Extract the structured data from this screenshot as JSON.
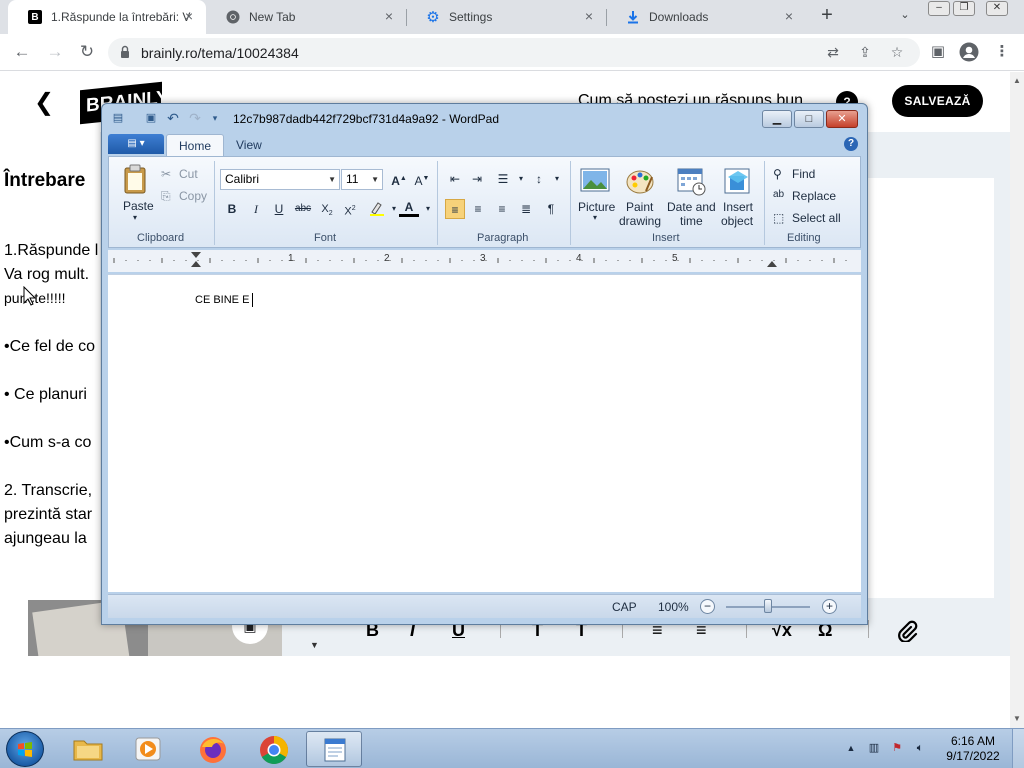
{
  "browser": {
    "tabs": [
      {
        "title": "1.Răspunde la întrebări: V",
        "favicon": "brainly-icon",
        "active": true
      },
      {
        "title": "New Tab",
        "favicon": "chrome-icon",
        "active": false
      },
      {
        "title": "Settings",
        "favicon": "gear-icon",
        "active": false
      },
      {
        "title": "Downloads",
        "favicon": "download-icon",
        "active": false
      }
    ],
    "url": "brainly.ro/tema/10024384"
  },
  "page": {
    "logo": "BRAINLY",
    "how_to_answer": "Cum să postezi un răspuns bun",
    "save_button": "SALVEAZĂ",
    "question_heading": "Întrebare",
    "question_lines": [
      "1.Răspunde l",
      "Va rog mult.",
      "puncte!!!!!",
      "•Ce fel de co",
      "• Ce planuri",
      "•Cum s-a co",
      "2. Transcrie,",
      "prezintă star",
      "ajungeau la"
    ],
    "editor_tools": [
      "B",
      "I",
      "U",
      "T",
      "T",
      "≡",
      "≡",
      "√x",
      "Ω",
      "attach"
    ]
  },
  "wordpad": {
    "title": "12c7b987dadb442f729bcf731d4a9a92 - WordPad",
    "tabs": [
      "Home",
      "View"
    ],
    "clipboard": {
      "paste": "Paste",
      "cut": "Cut",
      "copy": "Copy",
      "label": "Clipboard"
    },
    "font": {
      "family": "Calibri",
      "size": "11",
      "label": "Font"
    },
    "paragraph_label": "Paragraph",
    "insert": {
      "picture": "Picture",
      "paint1": "Paint",
      "paint2": "drawing",
      "date1": "Date and",
      "date2": "time",
      "obj1": "Insert",
      "obj2": "object",
      "label": "Insert"
    },
    "editing": {
      "find": "Find",
      "replace": "Replace",
      "select_all": "Select all",
      "label": "Editing"
    },
    "ruler_numbers": [
      "1",
      "2",
      "3",
      "4",
      "5"
    ],
    "document_text": "CE BINE E",
    "status": {
      "caps": "CAP",
      "zoom": "100%"
    }
  },
  "taskbar": {
    "apps": [
      {
        "name": "windows-explorer",
        "icon": "folder-icon"
      },
      {
        "name": "media-player",
        "icon": "media-player-icon"
      },
      {
        "name": "firefox",
        "icon": "firefox-icon"
      },
      {
        "name": "chrome",
        "icon": "chrome-icon"
      },
      {
        "name": "wordpad",
        "icon": "wordpad-icon"
      }
    ],
    "time": "6:16 AM",
    "date": "9/17/2022"
  },
  "colors": {
    "chrome_tabstrip": "#dee1e6",
    "brainly_black": "#000000",
    "page_band": "#ebf0f4",
    "wordpad_frame": "#b9d1ea",
    "taskbar": "#9ab6d6"
  }
}
